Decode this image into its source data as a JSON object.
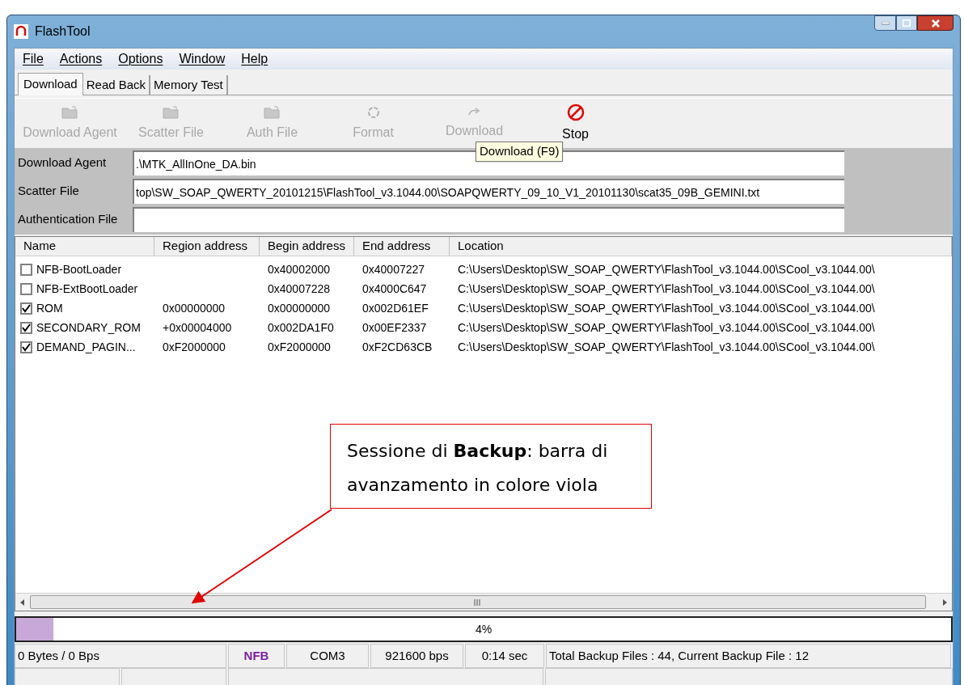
{
  "window": {
    "title": "FlashTool"
  },
  "menu": [
    "File",
    "Actions",
    "Options",
    "Window",
    "Help"
  ],
  "tabs": [
    {
      "label": "Download",
      "selected": true
    },
    {
      "label": "Read Back",
      "selected": false
    },
    {
      "label": "Memory Test",
      "selected": false
    }
  ],
  "toolbar": [
    {
      "label": "Download Agent",
      "kind": "folder",
      "disabled": true
    },
    {
      "label": "Scatter File",
      "kind": "folder",
      "disabled": true
    },
    {
      "label": "Auth File",
      "kind": "folder",
      "disabled": true
    },
    {
      "label": "Format",
      "kind": "format",
      "disabled": true
    },
    {
      "label": "Download",
      "kind": "download",
      "disabled": true
    },
    {
      "label": "Stop",
      "kind": "stop",
      "disabled": false
    }
  ],
  "tooltip": "Download (F9)",
  "fields": [
    {
      "label": "Download Agent",
      "value": ".\\MTK_AllInOne_DA.bin"
    },
    {
      "label": "Scatter File",
      "value": "top\\SW_SOAP_QWERTY_20101215\\FlashTool_v3.1044.00\\SOAPQWERTY_09_10_V1_20101130\\scat35_09B_GEMINI.txt"
    },
    {
      "label": "Authentication File"
    }
  ],
  "table": {
    "columns": [
      "Name",
      "Region address",
      "Begin address",
      "End address",
      "Location"
    ],
    "rows": [
      {
        "checked": false,
        "cells": [
          "NFB-BootLoader",
          "",
          "0x40002000",
          "0x40007227",
          "C:\\Users\\Desktop\\SW_SOAP_QWERTY\\FlashTool_v3.1044.00\\SCool_v3.1044.00\\"
        ]
      },
      {
        "checked": false,
        "cells": [
          "NFB-ExtBootLoader",
          "",
          "0x40007228",
          "0x4000C647",
          "C:\\Users\\Desktop\\SW_SOAP_QWERTY\\FlashTool_v3.1044.00\\SCool_v3.1044.00\\"
        ]
      },
      {
        "checked": true,
        "cells": [
          "ROM",
          "0x00000000",
          "0x00000000",
          "0x002D61EF",
          "C:\\Users\\Desktop\\SW_SOAP_QWERTY\\FlashTool_v3.1044.00\\SCool_v3.1044.00\\"
        ]
      },
      {
        "checked": true,
        "cells": [
          "SECONDARY_ROM",
          "+0x00004000",
          "0x002DA1F0",
          "0x00EF2337",
          "C:\\Users\\Desktop\\SW_SOAP_QWERTY\\FlashTool_v3.1044.00\\SCool_v3.1044.00\\"
        ]
      },
      {
        "checked": true,
        "cells": [
          "DEMAND_PAGIN...",
          "0xF2000000",
          "0xF2000000",
          "0xF2CD63CB",
          "C:\\Users\\Desktop\\SW_SOAP_QWERTY\\FlashTool_v3.1044.00\\SCool_v3.1044.00\\"
        ]
      }
    ]
  },
  "annotation": {
    "text": "Sessione di **Backup**: barra di avanzamento in colore viola"
  },
  "progress": {
    "level": 0.04,
    "reading": "4%",
    "color": "#c8a8d8"
  },
  "status_bar": [
    {
      "text": "0 Bytes / 0 Bps",
      "color": "#000000"
    },
    {
      "text": "NFB",
      "color": "#7a1fa2"
    },
    {
      "text": "COM3",
      "color": "#000000"
    },
    {
      "text": "921600 bps",
      "color": "#000000"
    },
    {
      "text": "0:14 sec",
      "color": "#000000"
    },
    {
      "text": "Total Backup Files : 44, Current Backup File : 12",
      "color": "#000000"
    }
  ]
}
